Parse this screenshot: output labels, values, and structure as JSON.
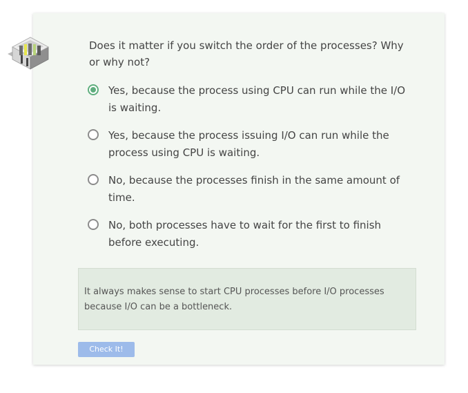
{
  "question": "Does it matter if you switch the order of the processes? Why or why not?",
  "options": [
    {
      "label": "Yes, because the process using CPU can run while the I/O is waiting.",
      "selected": true
    },
    {
      "label": "Yes, because the process issuing I/O can run while the process using CPU is waiting.",
      "selected": false
    },
    {
      "label": "No, because the processes finish in the same amount of time.",
      "selected": false
    },
    {
      "label": "No, both processes have to wait for the first to finish before executing.",
      "selected": false
    }
  ],
  "feedback": "It always makes sense to start CPU processes before I/O processes because I/O can be a bottleneck.",
  "check_button_label": "Check It!",
  "logo_icon": "server-rack-icon",
  "colors": {
    "card_bg": "#f3f7f2",
    "feedback_bg": "#e2ebe1",
    "selected_radio": "#5fae7e",
    "button_bg": "#9dbbea"
  }
}
